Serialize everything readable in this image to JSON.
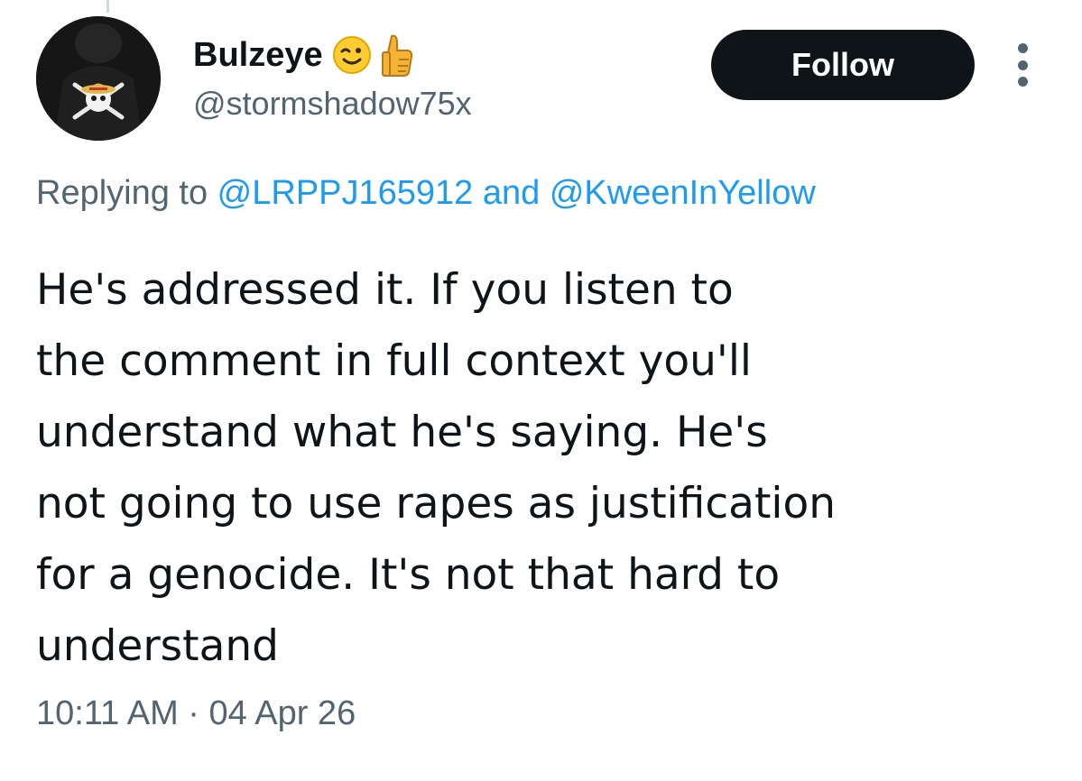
{
  "author": {
    "display_name": "Bulzeye",
    "handle": "@stormshadow75x",
    "badges": [
      "winking-face-emoji",
      "thumbs-up-emoji"
    ],
    "avatar_icon": "straw-hat-jolly-roger-avatar"
  },
  "actions": {
    "follow_label": "Follow",
    "more_icon": "more-vertical-icon"
  },
  "reply": {
    "prefix": "Replying to ",
    "mention_1": "@LRPPJ165912",
    "conjunction": " and ",
    "mention_2": "@KweenInYellow"
  },
  "tweet": {
    "lines": [
      "He's addressed it. If you listen to",
      "the comment in full context you'll",
      "understand what he's saying. He's",
      "not going to use rapes as justification",
      "for a genocide. It's not that hard to",
      "understand"
    ]
  },
  "meta": {
    "time": "10:11 AM",
    "separator": " · ",
    "date": "04 Apr 26"
  },
  "colors": {
    "text_primary": "#0f1419",
    "text_secondary": "#536471",
    "link": "#1d9bf0",
    "button_bg": "#0f1419"
  }
}
